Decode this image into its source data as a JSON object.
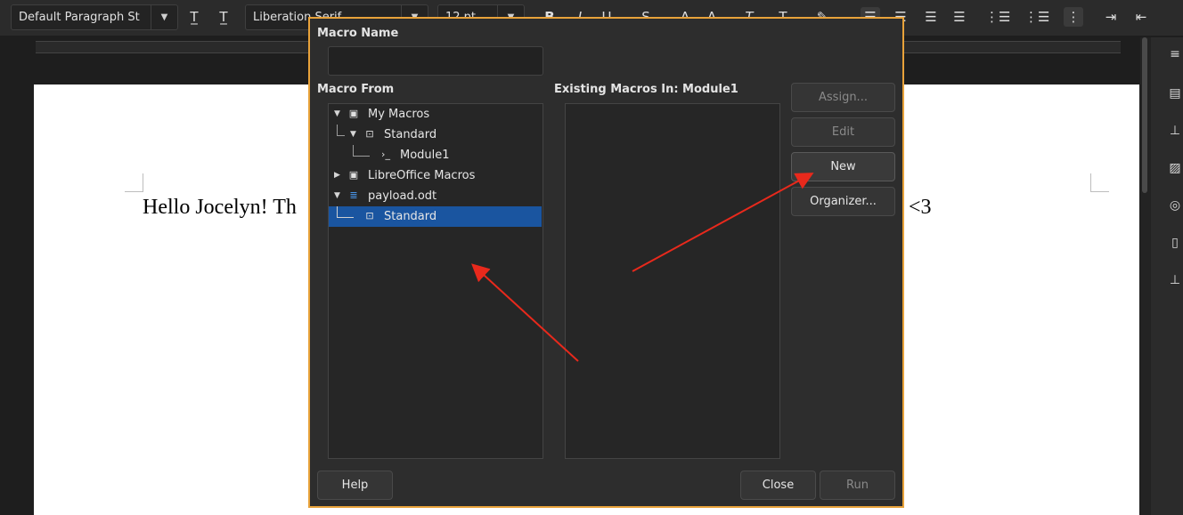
{
  "toolbar": {
    "paragraph_style": "Default Paragraph St",
    "font_name": "Liberation Serif",
    "font_size": "12 pt"
  },
  "document": {
    "text_left": "Hello Jocelyn! Th",
    "text_right": "<3"
  },
  "dialog": {
    "macro_name_label": "Macro Name",
    "macro_name_value": "",
    "macro_from_label": "Macro From",
    "existing_label": "Existing Macros In: Module1",
    "tree": [
      {
        "label": "My Macros",
        "icon": "library-icon",
        "expander": "expanded"
      },
      {
        "label": "Standard",
        "icon": "basic-library-icon",
        "expander": "expanded"
      },
      {
        "label": "Module1",
        "icon": "module-icon",
        "expander": "none"
      },
      {
        "label": "LibreOffice Macros",
        "icon": "library-icon",
        "expander": "collapsed"
      },
      {
        "label": "payload.odt",
        "icon": "document-icon",
        "expander": "expanded"
      },
      {
        "label": "Standard",
        "icon": "basic-library-icon",
        "expander": "none",
        "selected": true
      }
    ],
    "existing_macros": [],
    "buttons": {
      "assign": "Assign...",
      "edit": "Edit",
      "new": "New",
      "organizer": "Organizer...",
      "help": "Help",
      "close": "Close",
      "run": "Run"
    }
  },
  "colors": {
    "dialog_border": "#e8a23a",
    "selection": "#1a55a0",
    "annotation_arrow": "#e8291c"
  }
}
